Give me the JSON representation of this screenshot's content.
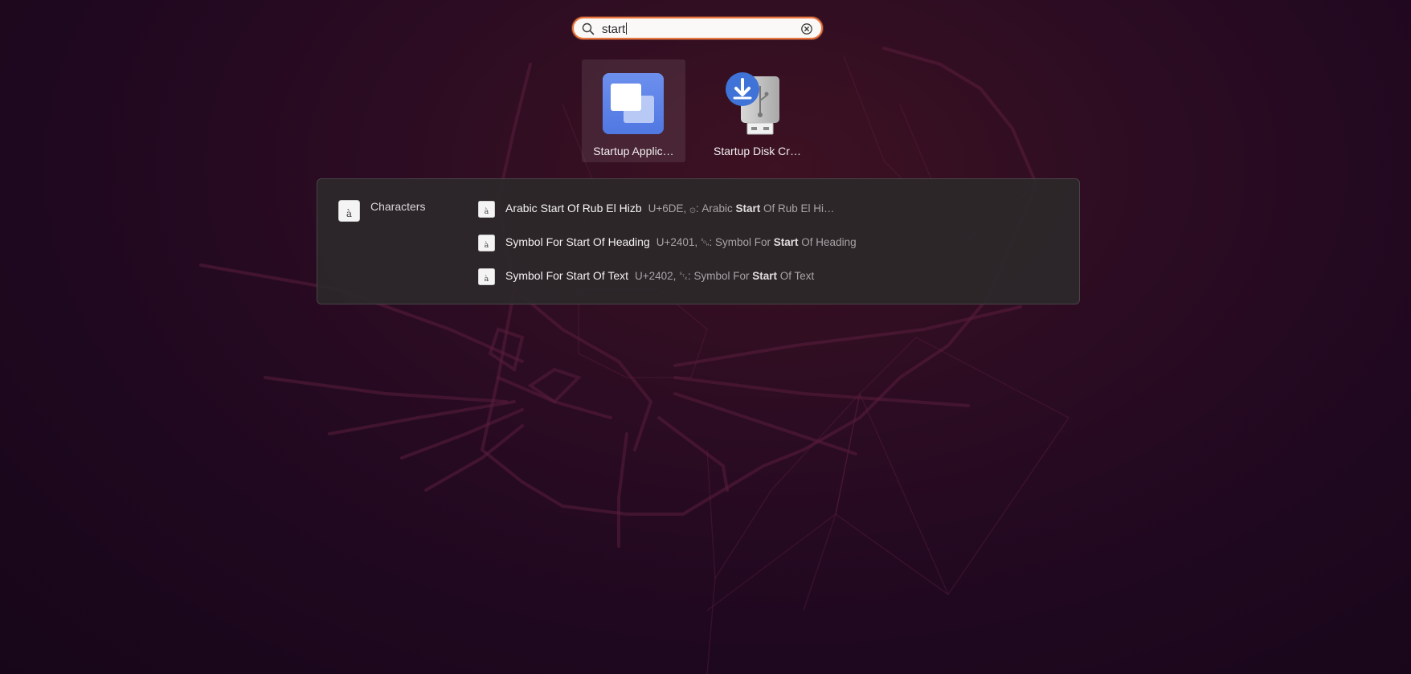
{
  "search": {
    "query": "start",
    "icon": "search-icon",
    "clear_icon": "clear-icon"
  },
  "apps": [
    {
      "label": "Startup Applic…",
      "icon": "startup-applications-icon",
      "selected": true
    },
    {
      "label": "Startup Disk Cr…",
      "icon": "startup-disk-creator-icon",
      "selected": false
    }
  ],
  "results": {
    "provider": {
      "name": "Characters",
      "icon": "characters-app-icon"
    },
    "items": [
      {
        "name": "Arabic Start Of Rub El Hizb",
        "desc_pre": "U+6DE, ۞: Arabic ",
        "desc_bold": "Start",
        "desc_post": " Of Rub El Hi…"
      },
      {
        "name": "Symbol For Start Of Heading",
        "desc_pre": "U+2401, ␁: Symbol For ",
        "desc_bold": "Start",
        "desc_post": " Of Heading"
      },
      {
        "name": "Symbol For Start Of Text",
        "desc_pre": "U+2402, ␂: Symbol For ",
        "desc_bold": "Start",
        "desc_post": " Of Text"
      }
    ]
  },
  "colors": {
    "accent": "#e9773f",
    "background": "#2c0c22",
    "panel": "#2c282a"
  }
}
